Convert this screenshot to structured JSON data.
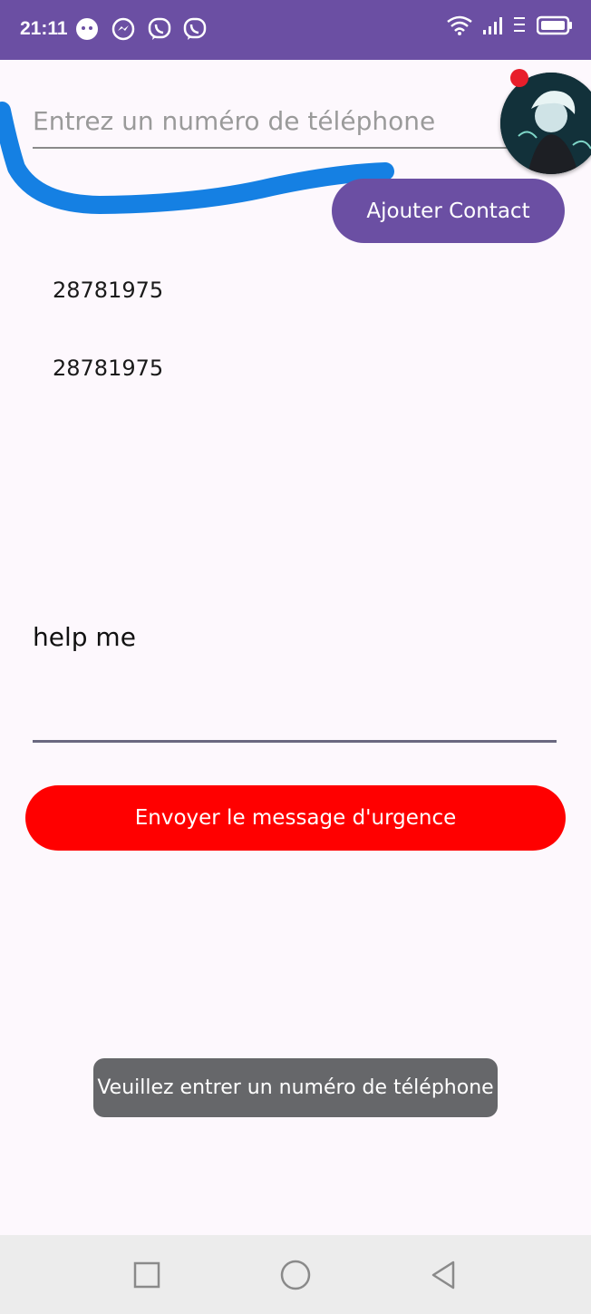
{
  "status_bar": {
    "time": "21:11",
    "notification_icons": [
      "app-icon",
      "messenger-icon",
      "viber-icon",
      "viber-icon"
    ],
    "background": "#6b4fa3"
  },
  "phone_input": {
    "placeholder": "Entrez un numéro de téléphone",
    "value": ""
  },
  "add_contact_button": {
    "label": "Ajouter Contact",
    "color": "#6b4fa3"
  },
  "contacts": [
    "28781975",
    "28781975"
  ],
  "message_input": {
    "value": "help me"
  },
  "emergency_button": {
    "label": "Envoyer le message d'urgence",
    "color": "#ff0000"
  },
  "toast": {
    "text": "Veuillez entrer un numéro de téléphone"
  },
  "nav_bar": {
    "buttons": [
      "recents-icon",
      "home-icon",
      "back-icon"
    ]
  }
}
